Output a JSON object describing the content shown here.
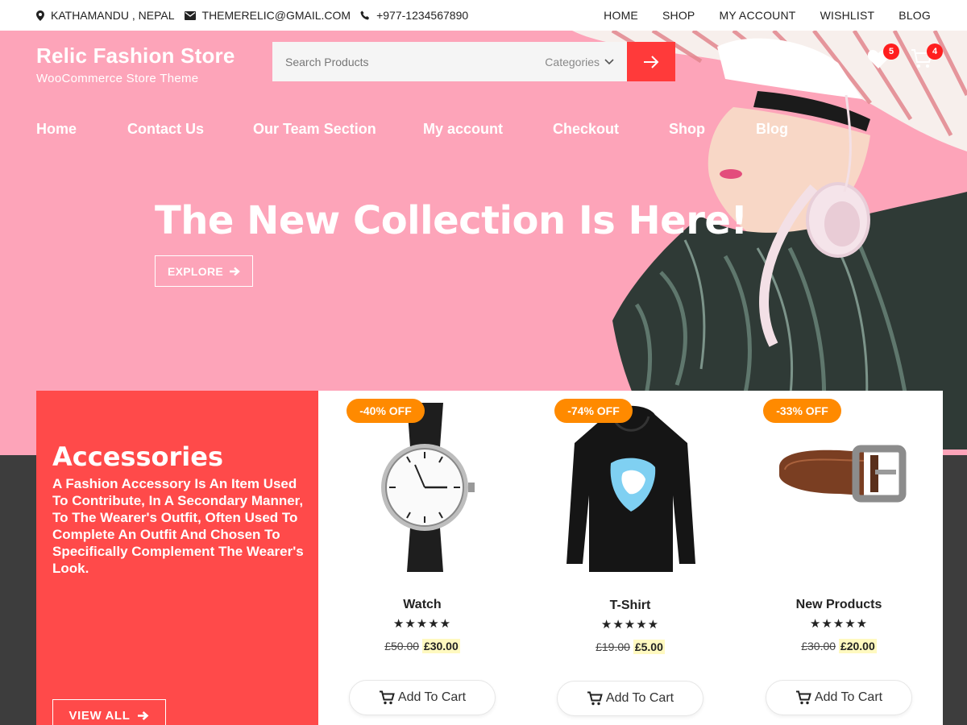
{
  "topbar": {
    "location": "KATHAMANDU , NEPAL",
    "email": "THEMERELIC@GMAIL.COM",
    "phone": "+977-1234567890",
    "links": [
      "HOME",
      "SHOP",
      "MY ACCOUNT",
      "WISHLIST",
      "BLOG"
    ]
  },
  "header": {
    "site_title": "Relic Fashion Store",
    "tagline": "WooCommerce Store Theme",
    "search": {
      "placeholder": "Search Products",
      "categories_label": "Categories"
    },
    "wishlist_count": "5",
    "cart_count": "4"
  },
  "main_nav": [
    "Home",
    "Contact Us",
    "Our Team Section",
    "My account",
    "Checkout",
    "Shop",
    "Blog"
  ],
  "hero": {
    "title": "The New Collection Is Here!",
    "button_label": "EXPLORE"
  },
  "accessories": {
    "title": "Accessories",
    "description": "A Fashion Accessory Is An Item Used To Contribute, In A Secondary Manner, To The Wearer's Outfit, Often Used To Complete An Outfit And Chosen To Specifically Complement The Wearer's Look.",
    "button_label": "VIEW ALL"
  },
  "products": [
    {
      "discount": "-40% OFF",
      "name": "Watch",
      "rating": "★★★★★",
      "old_price": "£50.00",
      "price": "£30.00",
      "cart_label": "Add To Cart"
    },
    {
      "discount": "-74% OFF",
      "name": "T-Shirt",
      "rating": "★★★★★",
      "old_price": "£19.00",
      "price": "£5.00",
      "cart_label": "Add To Cart"
    },
    {
      "discount": "-33% OFF",
      "name": "New Products",
      "rating": "★★★★★",
      "old_price": "£30.00",
      "price": "£20.00",
      "cart_label": "Add To Cart"
    }
  ],
  "colors": {
    "hero_pink": "#fda4b9",
    "accent_red": "#ff3a3a",
    "discount_orange": "#ff8a00",
    "dark_band": "#3d3d3d"
  }
}
